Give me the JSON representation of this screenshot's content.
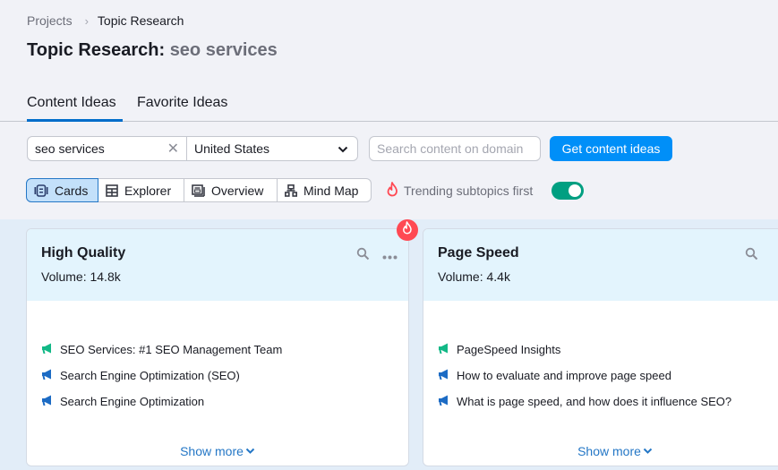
{
  "breadcrumb": {
    "items": [
      "Projects",
      "Topic Research"
    ]
  },
  "page_title": {
    "label": "Topic Research:",
    "query": "seo services"
  },
  "tabs": [
    {
      "label": "Content Ideas",
      "active": true
    },
    {
      "label": "Favorite Ideas",
      "active": false
    }
  ],
  "query_bar": {
    "keyword_value": "seo services",
    "country_value": "United States",
    "domain_placeholder": "Search content on domain",
    "submit_label": "Get content ideas"
  },
  "view_switch": [
    {
      "label": "Cards",
      "icon": "cards-icon",
      "active": true
    },
    {
      "label": "Explorer",
      "icon": "table-icon",
      "active": false
    },
    {
      "label": "Overview",
      "icon": "overview-icon",
      "active": false
    },
    {
      "label": "Mind Map",
      "icon": "mind-map-icon",
      "active": false
    }
  ],
  "trending": {
    "label": "Trending subtopics first",
    "enabled": true
  },
  "colors": {
    "accent_blue": "#008ff8",
    "tab_underline": "#006dca",
    "toggle_on": "#009f81",
    "trending_red": "#ff4953",
    "headline_green": "#12b886",
    "question_blue": "#1c6bc4",
    "link_blue": "#2477c6"
  },
  "cards": [
    {
      "title": "High Quality",
      "volume_label": "Volume:",
      "volume": "14.8k",
      "trending": true,
      "ideas": [
        {
          "text": "SEO Services: #1 SEO Management Team",
          "type": "top"
        },
        {
          "text": "Search Engine Optimization (SEO)",
          "type": "regular"
        },
        {
          "text": "Search Engine Optimization",
          "type": "regular"
        }
      ],
      "show_more": "Show more"
    },
    {
      "title": "Page Speed",
      "volume_label": "Volume:",
      "volume": "4.4k",
      "trending": false,
      "ideas": [
        {
          "text": "PageSpeed Insights",
          "type": "top"
        },
        {
          "text": "How to evaluate and improve page speed",
          "type": "regular"
        },
        {
          "text": "What is page speed, and how does it influence SEO?",
          "type": "regular"
        }
      ],
      "show_more": "Show more"
    }
  ]
}
